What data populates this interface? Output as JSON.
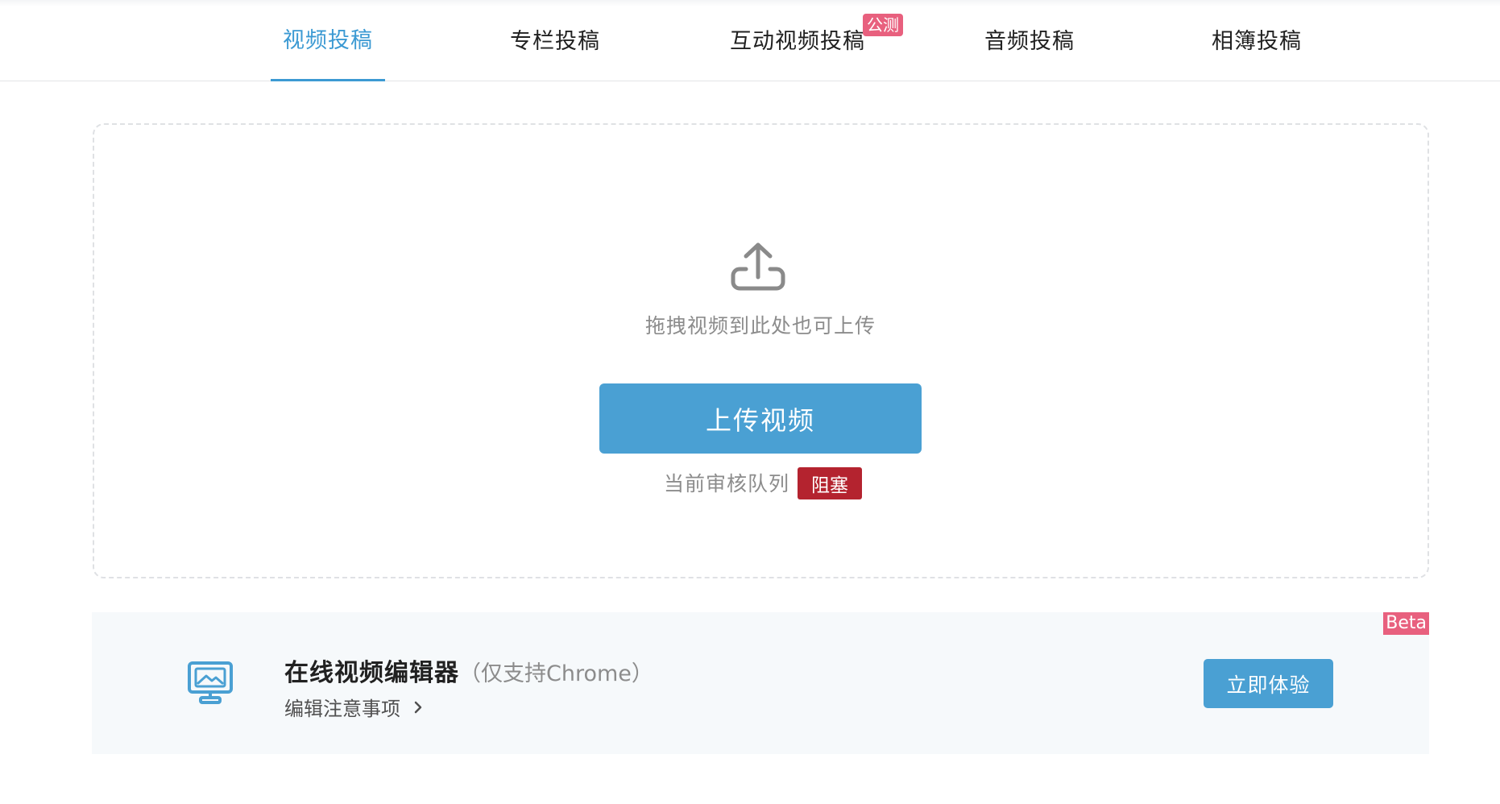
{
  "tabs": [
    {
      "label": "视频投稿",
      "active": true
    },
    {
      "label": "专栏投稿",
      "active": false
    },
    {
      "label": "互动视频投稿",
      "active": false,
      "badge": "公测"
    },
    {
      "label": "音频投稿",
      "active": false
    },
    {
      "label": "相簿投稿",
      "active": false
    }
  ],
  "upload": {
    "icon": "upload-icon",
    "drag_hint": "拖拽视频到此处也可上传",
    "button_label": "上传视频",
    "queue_label": "当前审核队列",
    "queue_status": "阻塞"
  },
  "editor": {
    "icon": "monitor-icon",
    "beta_badge": "Beta",
    "title": "在线视频编辑器",
    "subtitle": "（仅支持Chrome）",
    "notes_link": "编辑注意事项",
    "try_button": "立即体验"
  },
  "colors": {
    "accent": "#3c9ad3",
    "button": "#4aa0d3",
    "badge_pink": "#e8607e",
    "status_red": "#b4232f"
  }
}
